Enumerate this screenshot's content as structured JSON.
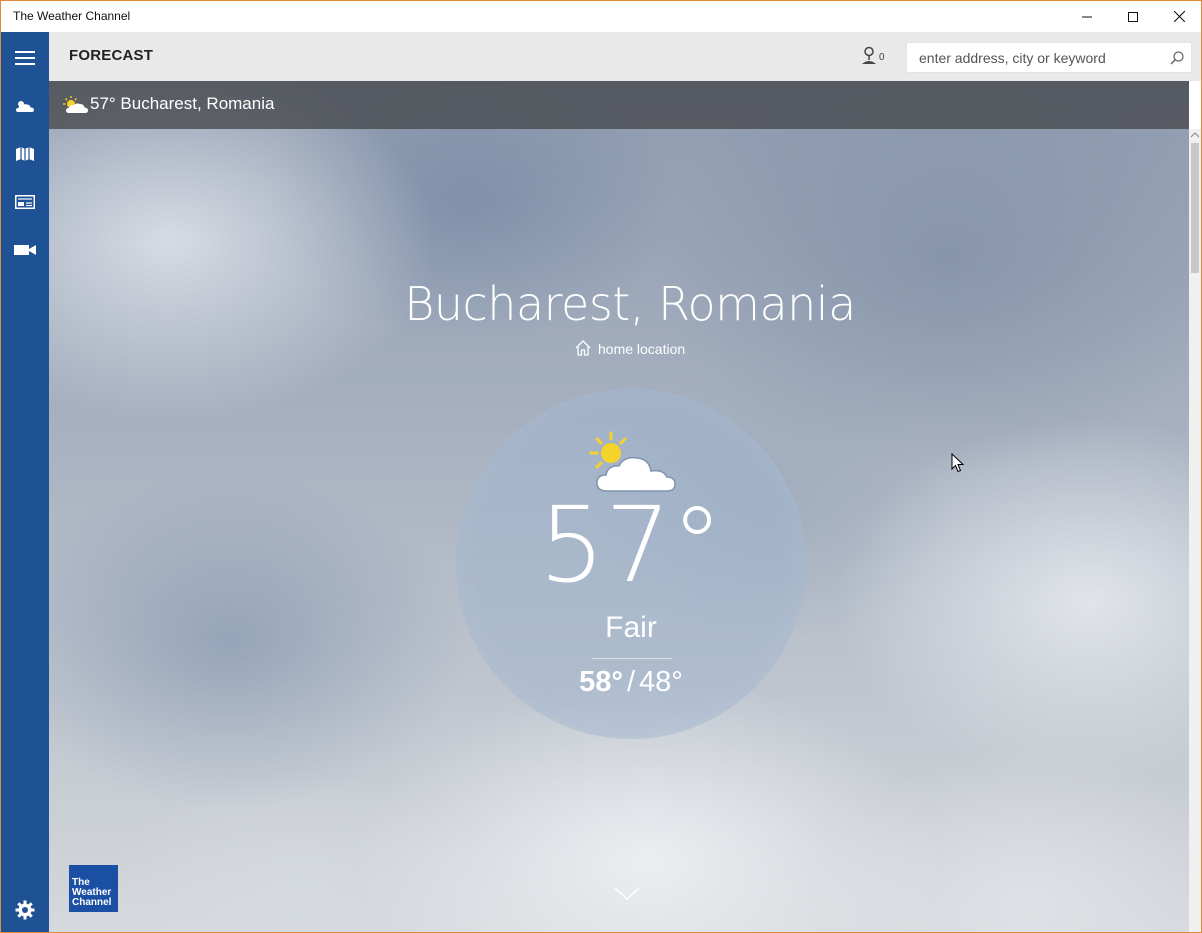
{
  "window": {
    "title": "The Weather Channel"
  },
  "nav": {
    "items": [
      {
        "name": "menu-icon"
      },
      {
        "name": "weather-icon"
      },
      {
        "name": "map-icon"
      },
      {
        "name": "news-icon"
      },
      {
        "name": "video-icon"
      },
      {
        "name": "settings-icon"
      }
    ]
  },
  "header": {
    "page_title": "FORECAST",
    "location_count": "0",
    "search_placeholder": "enter address, city or keyword"
  },
  "location_bar": {
    "text": "57° Bucharest, Romania",
    "icon": "partly-sunny-icon"
  },
  "current": {
    "city": "Bucharest, Romania",
    "home_label": "home location",
    "temp": "57°",
    "condition": "Fair",
    "high": "58°",
    "separator": "/",
    "low": "48°"
  },
  "brand": {
    "line1": "The",
    "line2": "Weather",
    "line3": "Channel"
  },
  "colors": {
    "nav_bg": "#1f5295",
    "header_bg": "#e9e9e9",
    "brand_bg": "#1a4fa3",
    "sun": "#f5d32a"
  }
}
